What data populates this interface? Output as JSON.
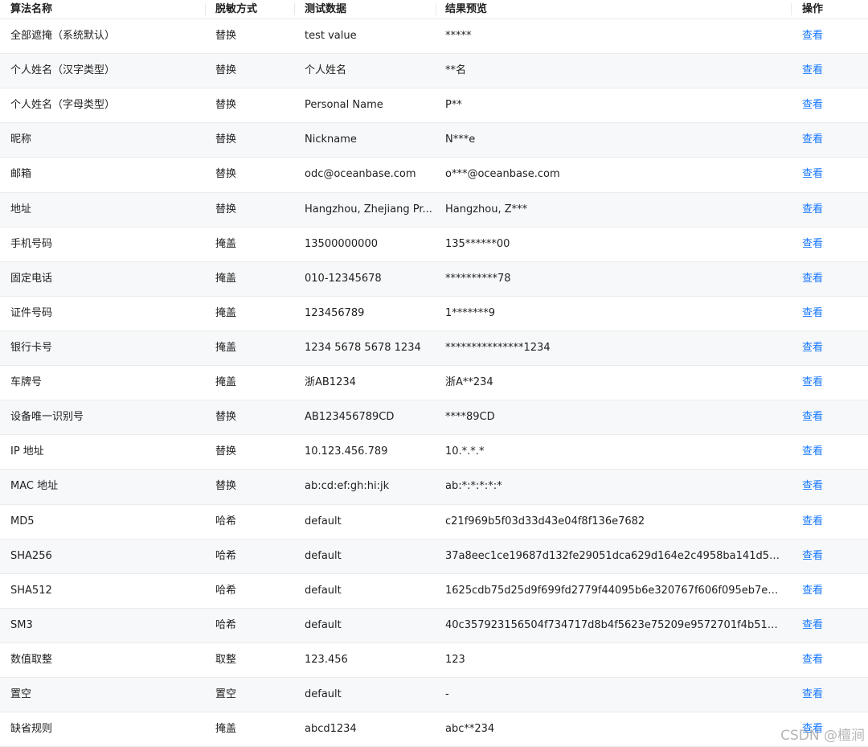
{
  "table": {
    "headers": {
      "name": "算法名称",
      "method": "脱敏方式",
      "test_data": "测试数据",
      "preview": "结果预览",
      "action": "操作"
    },
    "rows": [
      {
        "name": "全部遮掩（系统默认）",
        "method": "替换",
        "test_data": "test value",
        "preview": "*****",
        "action": "查看"
      },
      {
        "name": "个人姓名（汉字类型）",
        "method": "替换",
        "test_data": "个人姓名",
        "preview": "**名",
        "action": "查看"
      },
      {
        "name": "个人姓名（字母类型）",
        "method": "替换",
        "test_data": "Personal Name",
        "preview": "P**",
        "action": "查看"
      },
      {
        "name": "昵称",
        "method": "替换",
        "test_data": "Nickname",
        "preview": "N***e",
        "action": "查看"
      },
      {
        "name": "邮箱",
        "method": "替换",
        "test_data": "odc@oceanbase.com",
        "preview": "o***@oceanbase.com",
        "action": "查看"
      },
      {
        "name": "地址",
        "method": "替换",
        "test_data": "Hangzhou, Zhejiang Pr...",
        "preview": "Hangzhou, Z***",
        "action": "查看"
      },
      {
        "name": "手机号码",
        "method": "掩盖",
        "test_data": "13500000000",
        "preview": "135******00",
        "action": "查看"
      },
      {
        "name": "固定电话",
        "method": "掩盖",
        "test_data": "010-12345678",
        "preview": "**********78",
        "action": "查看"
      },
      {
        "name": "证件号码",
        "method": "掩盖",
        "test_data": "123456789",
        "preview": "1*******9",
        "action": "查看"
      },
      {
        "name": "银行卡号",
        "method": "掩盖",
        "test_data": "1234 5678 5678 1234",
        "preview": "***************1234",
        "action": "查看"
      },
      {
        "name": "车牌号",
        "method": "掩盖",
        "test_data": "浙AB1234",
        "preview": "浙A**234",
        "action": "查看"
      },
      {
        "name": "设备唯一识别号",
        "method": "替换",
        "test_data": "AB123456789CD",
        "preview": "****89CD",
        "action": "查看"
      },
      {
        "name": "IP 地址",
        "method": "替换",
        "test_data": "10.123.456.789",
        "preview": "10.*.*.*",
        "action": "查看"
      },
      {
        "name": "MAC 地址",
        "method": "替换",
        "test_data": "ab:cd:ef:gh:hi:jk",
        "preview": "ab:*:*:*:*:*",
        "action": "查看"
      },
      {
        "name": "MD5",
        "method": "哈希",
        "test_data": "default",
        "preview": "c21f969b5f03d33d43e04f8f136e7682",
        "action": "查看"
      },
      {
        "name": "SHA256",
        "method": "哈希",
        "test_data": "default",
        "preview": "37a8eec1ce19687d132fe29051dca629d164e2c4958ba141d5f4...",
        "action": "查看"
      },
      {
        "name": "SHA512",
        "method": "哈希",
        "test_data": "default",
        "preview": "1625cdb75d25d9f699fd2779f44095b6e320767f606f095eb7ed...",
        "action": "查看"
      },
      {
        "name": "SM3",
        "method": "哈希",
        "test_data": "default",
        "preview": "40c357923156504f734717d8b4f5623e75209e9572701f4b51ef...",
        "action": "查看"
      },
      {
        "name": "数值取整",
        "method": "取整",
        "test_data": "123.456",
        "preview": "123",
        "action": "查看"
      },
      {
        "name": "置空",
        "method": "置空",
        "test_data": "default",
        "preview": "-",
        "action": "查看"
      },
      {
        "name": "缺省规则",
        "method": "掩盖",
        "test_data": "abcd1234",
        "preview": "abc**234",
        "action": "查看"
      }
    ]
  },
  "watermark": "CSDN @檀涧",
  "colors": {
    "link": "#1677ff",
    "alt_row": "#f7f8fa",
    "border": "#ebebeb"
  }
}
